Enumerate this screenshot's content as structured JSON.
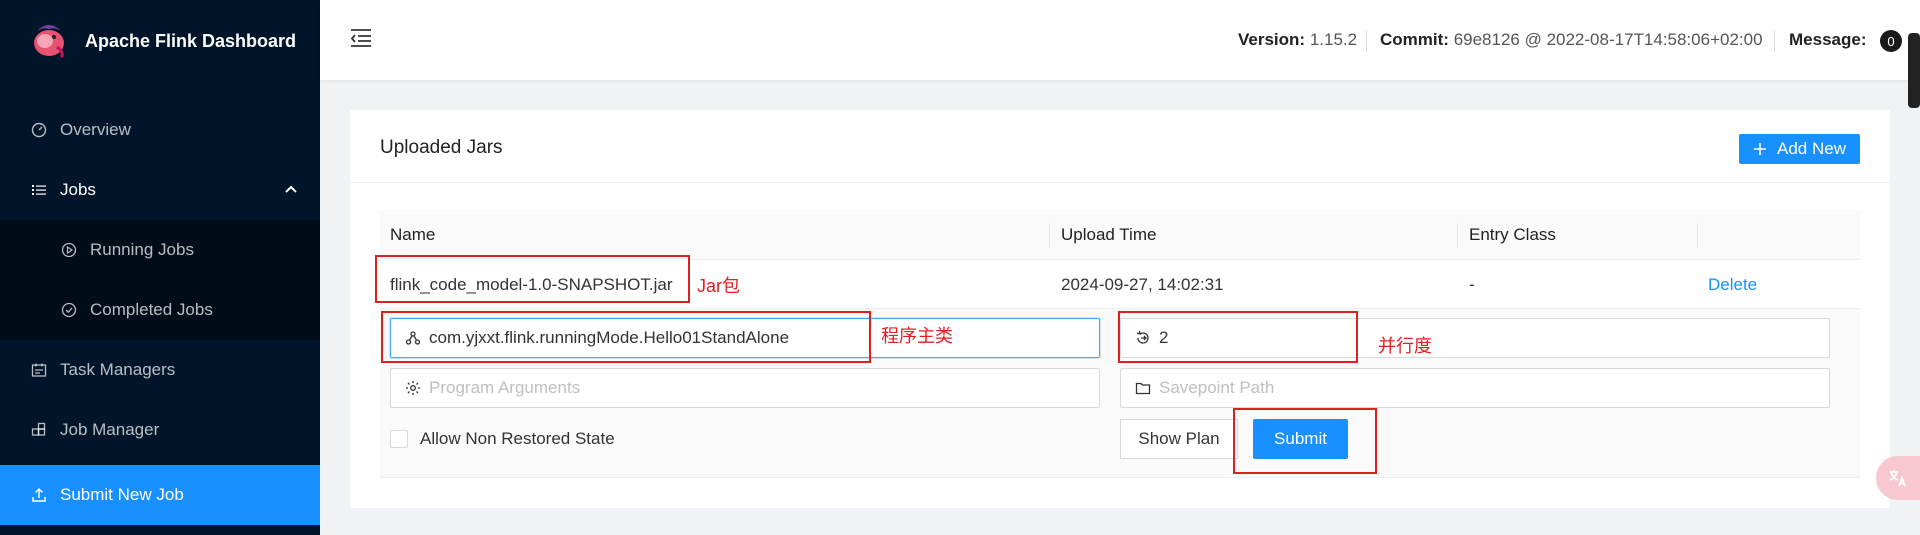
{
  "app": {
    "title": "Apache Flink Dashboard"
  },
  "sidebar": {
    "items": [
      {
        "label": "Overview",
        "icon": "dashboard-icon"
      },
      {
        "label": "Jobs",
        "icon": "list-icon"
      },
      {
        "label": "Running Jobs",
        "icon": "play-circle-icon"
      },
      {
        "label": "Completed Jobs",
        "icon": "check-circle-icon"
      },
      {
        "label": "Task Managers",
        "icon": "schedule-icon"
      },
      {
        "label": "Job Manager",
        "icon": "build-icon"
      },
      {
        "label": "Submit New Job",
        "icon": "upload-icon"
      }
    ]
  },
  "header": {
    "version_label": "Version:",
    "version_value": "1.15.2",
    "commit_label": "Commit:",
    "commit_value": "69e8126 @ 2022-08-17T14:58:06+02:00",
    "message_label": "Message:",
    "message_count": "0"
  },
  "card": {
    "title": "Uploaded Jars",
    "add_button": "Add New"
  },
  "table": {
    "columns": [
      "Name",
      "Upload Time",
      "Entry Class",
      ""
    ],
    "rows": [
      {
        "name": "flink_code_model-1.0-SNAPSHOT.jar",
        "upload_time": "2024-09-27, 14:02:31",
        "entry_class": "-",
        "action": "Delete"
      }
    ]
  },
  "form": {
    "entry_class_value": "com.yjxxt.flink.runningMode.Hello01StandAlone",
    "parallelism_value": "2",
    "program_args_placeholder": "Program Arguments",
    "savepoint_placeholder": "Savepoint Path",
    "allow_non_restored_label": "Allow Non Restored State",
    "show_plan_label": "Show Plan",
    "submit_label": "Submit"
  },
  "annotations": {
    "jar": "Jar包",
    "main_class": "程序主类",
    "parallelism": "并行度"
  },
  "colors": {
    "primary": "#1890ff",
    "sidebar": "#001529",
    "annotation": "#e02020"
  }
}
